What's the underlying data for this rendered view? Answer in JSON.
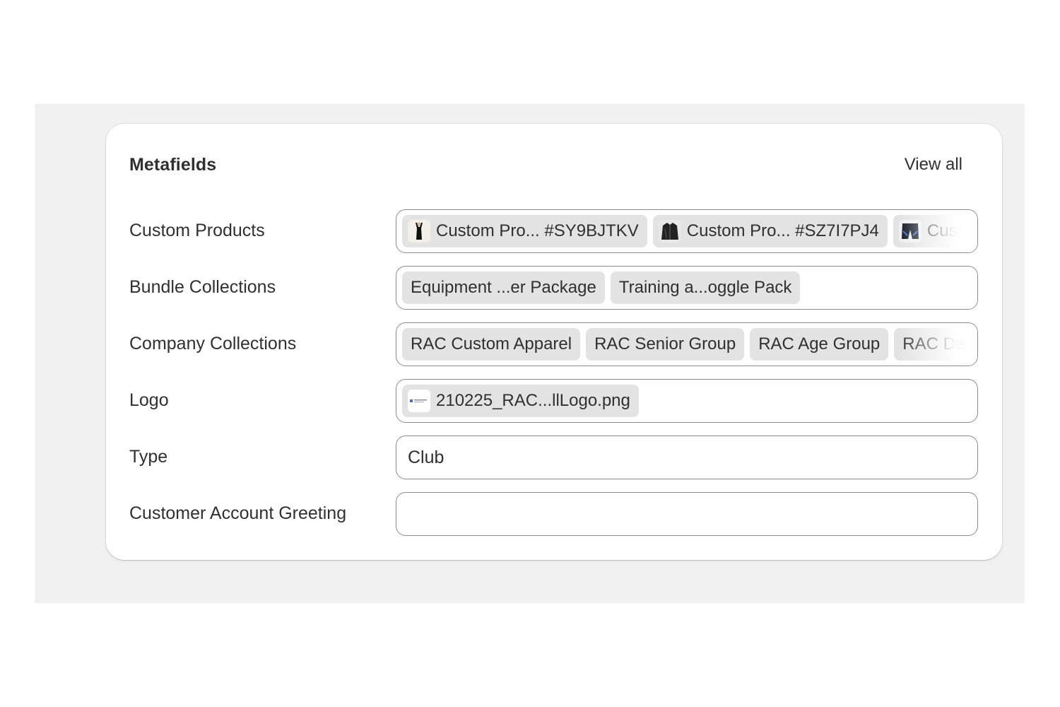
{
  "card": {
    "title": "Metafields",
    "view_all_label": "View all"
  },
  "rows": {
    "custom_products": {
      "label": "Custom Products",
      "chips": [
        {
          "text": "Custom Pro... #SY9BJTKV",
          "thumb": "swimsuit-thumbnail"
        },
        {
          "text": "Custom Pro... #SZ7I7PJ4",
          "thumb": "jacket-thumbnail"
        },
        {
          "text": "Cus",
          "thumb": "shorts-thumbnail"
        }
      ]
    },
    "bundle_collections": {
      "label": "Bundle Collections",
      "chips": [
        "Equipment ...er Package",
        "Training a...oggle Pack"
      ]
    },
    "company_collections": {
      "label": "Company Collections",
      "chips": [
        "RAC Custom Apparel",
        "RAC Senior Group",
        "RAC Age Group",
        "RAC De"
      ]
    },
    "logo": {
      "label": "Logo",
      "chips": [
        {
          "text": "210225_RAC...llLogo.png",
          "thumb": "logo-thumbnail"
        }
      ]
    },
    "type": {
      "label": "Type",
      "value": "Club"
    },
    "customer_account_greeting": {
      "label": "Customer Account Greeting",
      "value": ""
    }
  },
  "colors": {
    "backdrop": "#f1f1f1",
    "chip_bg": "#e3e3e3",
    "text": "#303030",
    "field_border": "#8a8a8a"
  }
}
